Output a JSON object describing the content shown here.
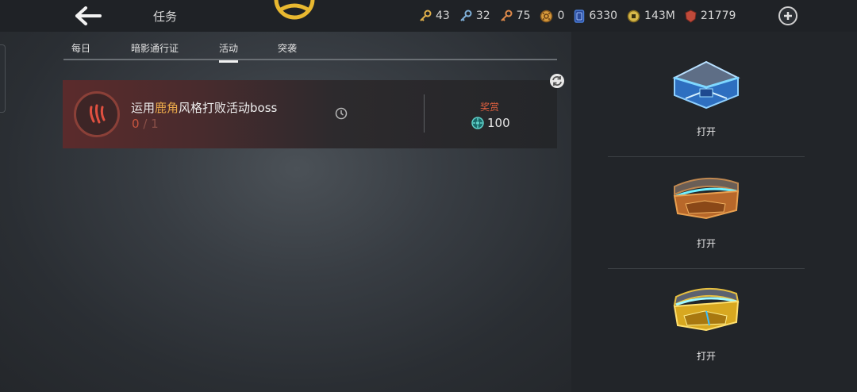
{
  "header": {
    "title": "任务",
    "currencies": [
      {
        "icon": "gold-key-icon",
        "value": "43",
        "color": "#e0b04a"
      },
      {
        "icon": "blue-key-icon",
        "value": "32",
        "color": "#7fb0d8"
      },
      {
        "icon": "orange-key-icon",
        "value": "75",
        "color": "#e08a4a"
      },
      {
        "icon": "gold-coin-token-icon",
        "value": "0",
        "color": "#d79b3c"
      },
      {
        "icon": "blue-card-icon",
        "value": "6330",
        "color": "#4a7ed8"
      },
      {
        "icon": "gold-ring-coin-icon",
        "value": "143M",
        "color": "#d8b94a"
      },
      {
        "icon": "red-gem-icon",
        "value": "21779",
        "color": "#c04a3a"
      }
    ]
  },
  "tabs": [
    {
      "label": "每日",
      "active": false
    },
    {
      "label": "暗影通行证",
      "active": false
    },
    {
      "label": "活动",
      "active": true
    },
    {
      "label": "突袭",
      "active": false
    }
  ],
  "quest": {
    "title_prefix": "运用",
    "title_highlight": "鹿角",
    "title_suffix": "风格打败活动boss",
    "progress_current": "0",
    "progress_sep": "/",
    "progress_total": "1",
    "reward_label": "奖赏",
    "reward_value": "100"
  },
  "chests": [
    {
      "name": "blue-chest",
      "open_label": "打开"
    },
    {
      "name": "bronze-chest",
      "open_label": "打开"
    },
    {
      "name": "gold-chest",
      "open_label": "打开"
    }
  ]
}
